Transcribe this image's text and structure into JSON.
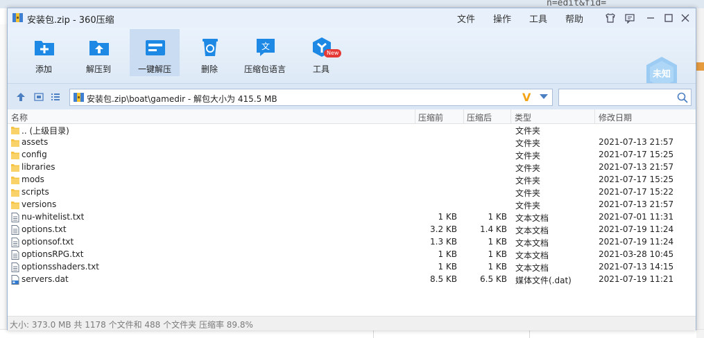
{
  "background": {
    "url_fragment": "n=edit&fid="
  },
  "window": {
    "title": "安装包.zip - 360压缩"
  },
  "menu": [
    "文件",
    "操作",
    "工具",
    "帮助"
  ],
  "toolbar": {
    "buttons": [
      {
        "label": "添加",
        "icon": "add-icon"
      },
      {
        "label": "解压到",
        "icon": "extract-to-icon"
      },
      {
        "label": "一键解压",
        "icon": "one-click-extract-icon"
      },
      {
        "label": "删除",
        "icon": "delete-icon"
      },
      {
        "label": "压缩包语言",
        "icon": "language-icon"
      },
      {
        "label": "工具",
        "icon": "tools-icon"
      }
    ],
    "new_badge": "New",
    "shield_label": "未知"
  },
  "address": {
    "path": "安装包.zip\\boat\\gamedir - 解包大小为 415.5 MB"
  },
  "columns": {
    "name": "名称",
    "packed": "压缩前",
    "unpacked": "压缩后",
    "type": "类型",
    "modified": "修改日期"
  },
  "files": [
    {
      "name": ".. (上级目录)",
      "packed": "",
      "unpacked": "",
      "type": "文件夹",
      "modified": "",
      "kind": "folder"
    },
    {
      "name": "assets",
      "packed": "",
      "unpacked": "",
      "type": "文件夹",
      "modified": "2021-07-13 21:57",
      "kind": "folder"
    },
    {
      "name": "config",
      "packed": "",
      "unpacked": "",
      "type": "文件夹",
      "modified": "2021-07-17 15:25",
      "kind": "folder"
    },
    {
      "name": "libraries",
      "packed": "",
      "unpacked": "",
      "type": "文件夹",
      "modified": "2021-07-13 21:57",
      "kind": "folder"
    },
    {
      "name": "mods",
      "packed": "",
      "unpacked": "",
      "type": "文件夹",
      "modified": "2021-07-17 15:25",
      "kind": "folder"
    },
    {
      "name": "scripts",
      "packed": "",
      "unpacked": "",
      "type": "文件夹",
      "modified": "2021-07-17 15:22",
      "kind": "folder"
    },
    {
      "name": "versions",
      "packed": "",
      "unpacked": "",
      "type": "文件夹",
      "modified": "2021-07-13 21:57",
      "kind": "folder"
    },
    {
      "name": "nu-whitelist.txt",
      "packed": "1 KB",
      "unpacked": "1 KB",
      "type": "文本文档",
      "modified": "2021-07-01 11:31",
      "kind": "text"
    },
    {
      "name": "options.txt",
      "packed": "3.2 KB",
      "unpacked": "1.4 KB",
      "type": "文本文档",
      "modified": "2021-07-19 11:24",
      "kind": "text"
    },
    {
      "name": "optionsof.txt",
      "packed": "1.3 KB",
      "unpacked": "1 KB",
      "type": "文本文档",
      "modified": "2021-07-19 11:24",
      "kind": "text"
    },
    {
      "name": "optionsRPG.txt",
      "packed": "1 KB",
      "unpacked": "1 KB",
      "type": "文本文档",
      "modified": "2021-03-28 10:45",
      "kind": "text"
    },
    {
      "name": "optionsshaders.txt",
      "packed": "1 KB",
      "unpacked": "1 KB",
      "type": "文本文档",
      "modified": "2021-07-13 14:15",
      "kind": "text"
    },
    {
      "name": "servers.dat",
      "packed": "8.5 KB",
      "unpacked": "6.5 KB",
      "type": "媒体文件(.dat)",
      "modified": "2021-07-19 11:21",
      "kind": "media"
    }
  ],
  "status": "大小: 373.0 MB 共 1178 个文件和 488 个文件夹 压缩率 89.8%",
  "colors": {
    "accent": "#1e88e5",
    "folder": "#f6c445",
    "titlebar": "#e8f1fb"
  }
}
